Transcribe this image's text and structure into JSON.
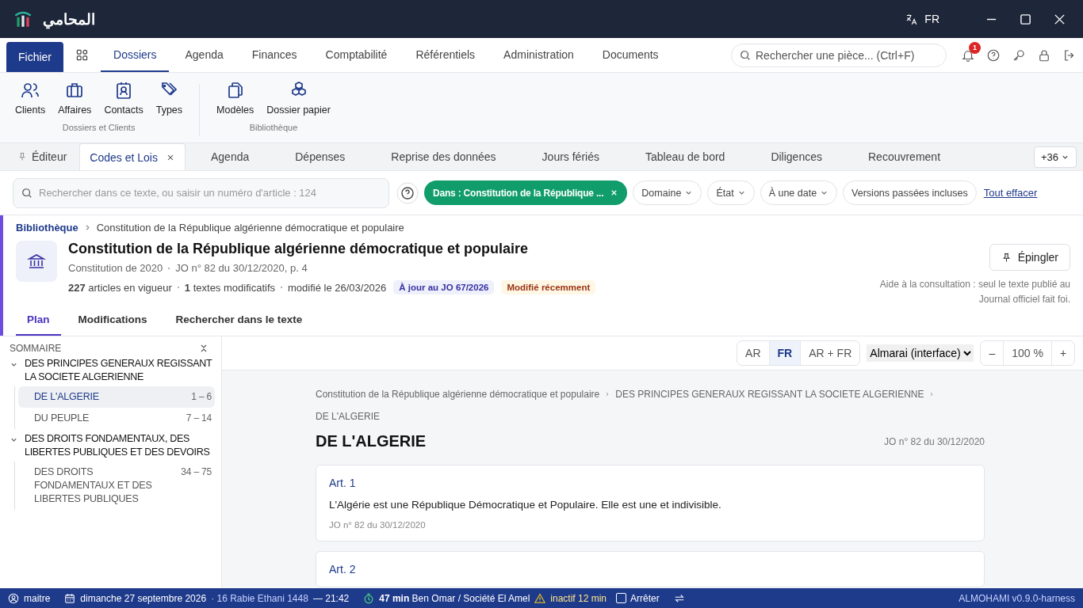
{
  "titlebar": {
    "app_name": "المحامي",
    "language": "FR"
  },
  "menu": {
    "file_button": "Fichier",
    "tabs": [
      {
        "label": "Dossiers",
        "selected": true
      },
      {
        "label": "Agenda",
        "selected": false
      },
      {
        "label": "Finances",
        "selected": false
      },
      {
        "label": "Comptabilité",
        "selected": false
      },
      {
        "label": "Référentiels",
        "selected": false
      },
      {
        "label": "Administration",
        "selected": false
      },
      {
        "label": "Documents",
        "selected": false
      }
    ],
    "search": {
      "placeholder": "Rechercher une pièce... (Ctrl+F)"
    },
    "notification_count": "1"
  },
  "ribbon": [
    {
      "title": "Dossiers et Clients",
      "items": [
        {
          "label": "Clients",
          "kind": "people"
        },
        {
          "label": "Affaires",
          "kind": "briefcase"
        },
        {
          "label": "Contacts",
          "kind": "contact"
        },
        {
          "label": "Types",
          "kind": "tag"
        }
      ]
    },
    {
      "title": "Bibliothèque",
      "items": [
        {
          "label": "Modèles",
          "kind": "files"
        },
        {
          "label": "Dossier papier",
          "kind": "boxes"
        }
      ]
    }
  ],
  "doc_tabs": {
    "tabs": [
      {
        "label": "Éditeur",
        "selected": false,
        "pinned": true,
        "closable": false
      },
      {
        "label": "Codes et Lois",
        "selected": true,
        "pinned": false,
        "closable": true
      },
      {
        "label": "Agenda",
        "selected": false,
        "pinned": false,
        "closable": false
      },
      {
        "label": "Dépenses",
        "selected": false,
        "pinned": false,
        "closable": false
      },
      {
        "label": "Reprise des données",
        "selected": false,
        "pinned": false,
        "closable": false
      },
      {
        "label": "Jours fériés",
        "selected": false,
        "pinned": false,
        "closable": false
      },
      {
        "label": "Tableau de bord",
        "selected": false,
        "pinned": false,
        "closable": false
      },
      {
        "label": "Diligences",
        "selected": false,
        "pinned": false,
        "closable": false
      },
      {
        "label": "Recouvrement",
        "selected": false,
        "pinned": false,
        "closable": false
      }
    ],
    "overflow": "+36"
  },
  "filters": {
    "search": {
      "placeholder": "Rechercher dans ce texte, ou saisir un numéro d'article : 124"
    },
    "active_chip": "Dans : Constitution de la République ...",
    "dropdowns": [
      "Domaine",
      "État",
      "À une date"
    ],
    "toggle": {
      "label": "Versions passées incluses",
      "on": false
    },
    "clear": "Tout effacer"
  },
  "header": {
    "breadcrumb": {
      "root": "Bibliothèque",
      "current": "Constitution de la République algérienne démocratique et populaire"
    },
    "title": "Constitution de la République algérienne démocratique et populaire",
    "meta": [
      "Constitution de 2020",
      "JO n° 82 du 30/12/2020, p. 4"
    ],
    "stats": [
      "**227** articles en vigueur",
      "**1** textes modificatifs",
      "modifié le 26/03/2026"
    ],
    "badges": [
      {
        "label": "À jour au JO 67/2026",
        "color": "#3730a3"
      },
      {
        "label": "Modifié récemment",
        "color": "#9a3412"
      }
    ],
    "pin_button": "Épingler",
    "disclaimer": "Aide à la consultation : seul le texte publié au Journal officiel fait foi.",
    "tabs": [
      {
        "label": "Plan",
        "selected": true
      },
      {
        "label": "Modifications",
        "selected": false
      },
      {
        "label": "Rechercher dans le texte",
        "selected": false
      }
    ]
  },
  "summary": {
    "heading": "SOMMAIRE",
    "tree": [
      {
        "label": "DES PRINCIPES GENERAUX REGISSANT LA SOCIETE ALGERIENNE",
        "expanded": true,
        "children": [
          {
            "label": "DE L'ALGERIE",
            "range": "1 – 6",
            "selected": true
          },
          {
            "label": "DU PEUPLE",
            "range": "7 – 14",
            "selected": false
          }
        ]
      },
      {
        "label": "DES DROITS FONDAMENTAUX, DES LIBERTES PUBLIQUES ET DES DEVOIRS",
        "expanded": true,
        "children": [
          {
            "label": "DES DROITS FONDAMENTAUX ET DES LIBERTES PUBLIQUES",
            "range": "34 – 75",
            "selected": false
          }
        ]
      }
    ]
  },
  "viewer": {
    "languages": [
      {
        "label": "AR",
        "selected": false
      },
      {
        "label": "FR",
        "selected": true
      },
      {
        "label": "AR + FR",
        "selected": false
      }
    ],
    "font": "Almarai (interface)",
    "zoom": "100 %",
    "zoom_out": "–",
    "zoom_in": "+",
    "breadcrumb": [
      "Constitution de la République algérienne démocratique et populaire",
      "DES PRINCIPES GENERAUX REGISSANT LA SOCIETE ALGERIENNE",
      "DE L'ALGERIE"
    ],
    "heading": "DE L'ALGERIE",
    "journal": "JO n° 82 du 30/12/2020",
    "articles": [
      {
        "number": "Art. 1",
        "text": "L'Algérie est une République Démocratique et Populaire. Elle est une et indivisible.",
        "source": "JO n° 82 du 30/12/2020"
      },
      {
        "number": "Art. 2"
      }
    ]
  },
  "status_bar": {
    "user": "maitre",
    "date": "dimanche 27 septembre 2026",
    "hijri": "· 16 Rabie Ethani 1448",
    "time": "— 21:42",
    "timer": "**47 min** Ben Omar / Société El Amel",
    "inactive": "inactif 12 min",
    "stop": {
      "label": "Arrêter",
      "checked": false
    },
    "version": "ALMOHAMI v0.9.0-harness"
  }
}
